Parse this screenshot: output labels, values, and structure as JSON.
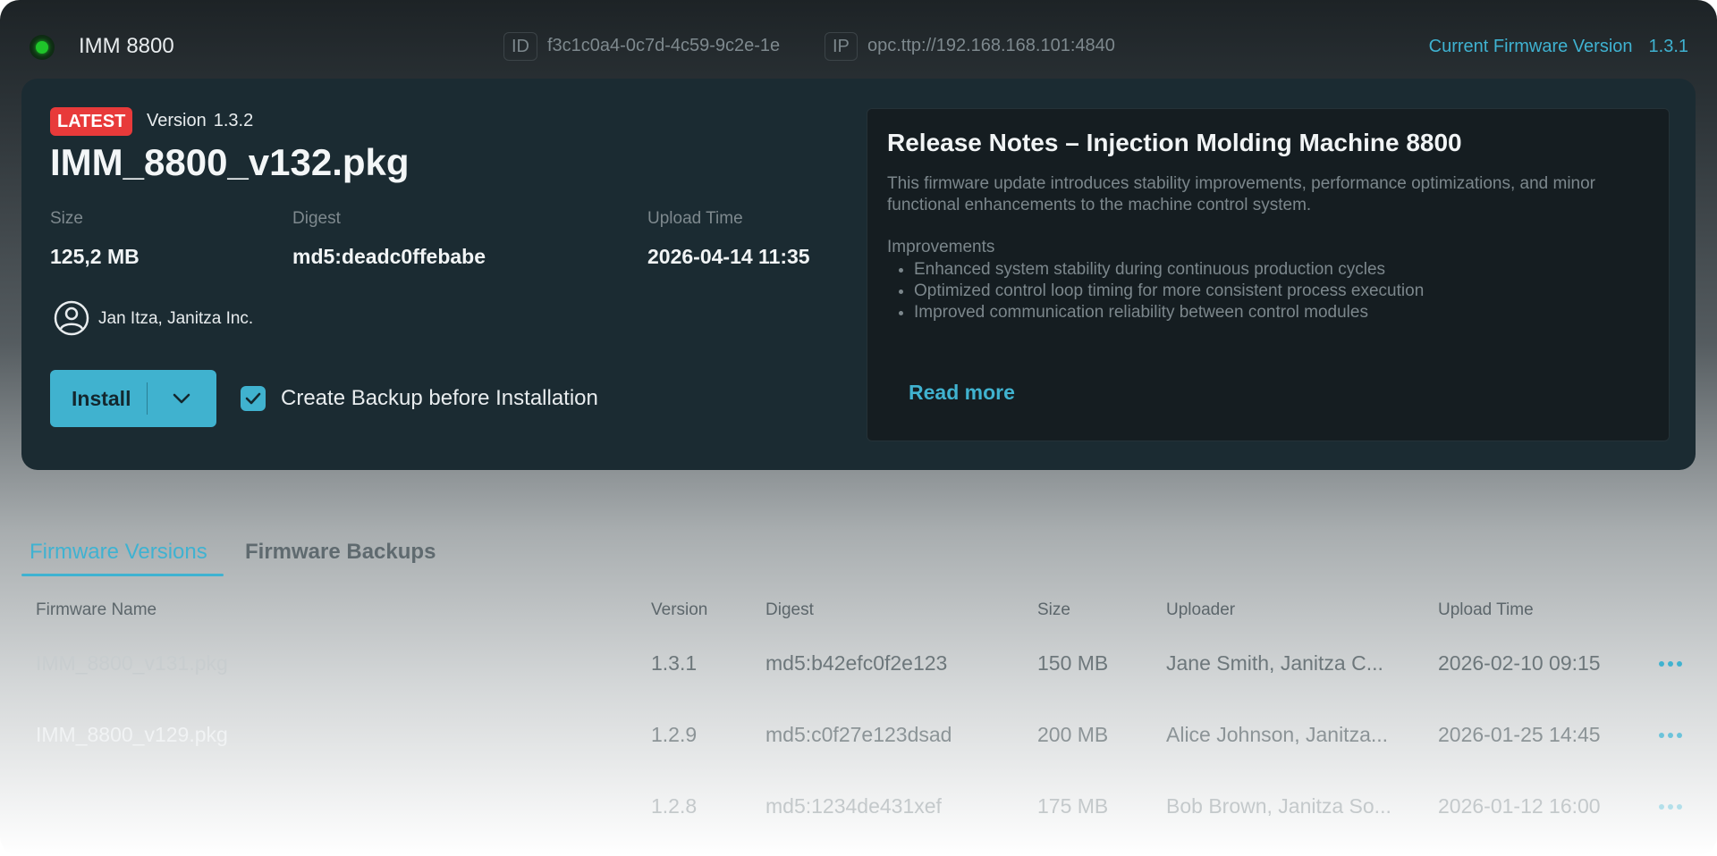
{
  "header": {
    "machine_name": "IMM 8800",
    "id_label": "ID",
    "id_value": "f3c1c0a4-0c7d-4c59-9c2e-1e",
    "ip_label": "IP",
    "ip_value": "opc.ttp://192.168.168.101:4840",
    "current_fw_label": "Current Firmware Version",
    "current_fw_value": "1.3.1",
    "status_color": "#1fc42a"
  },
  "card": {
    "badge": "LATEST",
    "version_label": "Version",
    "version_value": "1.3.2",
    "package_name": "IMM_8800_v132.pkg",
    "size_label": "Size",
    "size_value": "125,2 MB",
    "digest_label": "Digest",
    "digest_value": "md5:deadc0ffebabe",
    "upload_label": "Upload Time",
    "upload_value": "2026-04-14 11:35",
    "uploader": "Jan Itza, Janitza Inc.",
    "install_label": "Install",
    "backup_checkbox_label": "Create Backup before Installation",
    "backup_checked": true
  },
  "release_notes": {
    "title": "Release Notes – Injection Molding Machine 8800",
    "intro": "This firmware update introduces stability improvements, performance optimizations, and minor functional enhancements to the machine control system.",
    "subheading": "Improvements",
    "items": [
      "Enhanced system stability during continuous production cycles",
      "Optimized control loop timing for more consistent process execution",
      "Improved communication reliability between control modules"
    ],
    "read_more": "Read more"
  },
  "tabs": [
    {
      "label": "Firmware Versions",
      "active": true
    },
    {
      "label": "Firmware Backups",
      "active": false
    }
  ],
  "table": {
    "columns": [
      "Firmware Name",
      "Version",
      "Digest",
      "Size",
      "Uploader",
      "Upload Time"
    ],
    "rows": [
      [
        "IMM_8800_v131.pkg",
        "1.3.1",
        "md5:b42efc0f2e123",
        "150 MB",
        "Jane Smith, Janitza C...",
        "2026-02-10 09:15"
      ],
      [
        "IMM_8800_v129.pkg",
        "1.2.9",
        "md5:c0f27e123dsad",
        "200 MB",
        "Alice Johnson, Janitza...",
        "2026-01-25 14:45"
      ],
      [
        "",
        "1.2.8",
        "md5:1234de431xef",
        "175 MB",
        "Bob Brown, Janitza So...",
        "2026-01-12 16:00"
      ]
    ]
  },
  "colors": {
    "accent": "#40b2cf",
    "badge": "#e83a3a",
    "card_bg": "#1b2b32"
  }
}
